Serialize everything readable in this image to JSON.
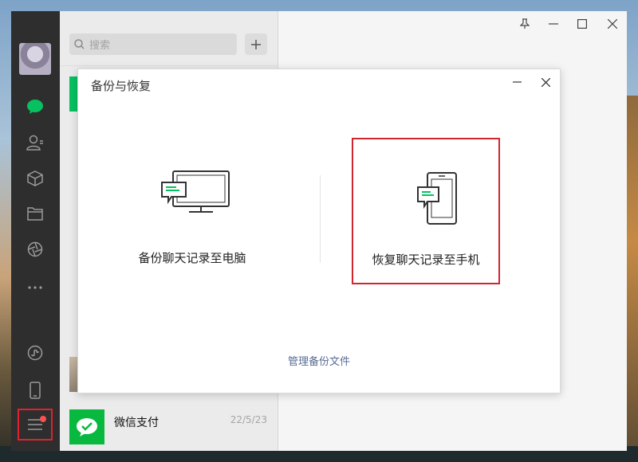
{
  "search": {
    "placeholder": "搜索"
  },
  "chat_list": [
    {
      "name": "微信支付",
      "date": "22/5/23"
    }
  ],
  "dialog": {
    "title": "备份与恢复",
    "options": [
      {
        "label": "备份聊天记录至电脑",
        "icon": "monitor-chat-icon",
        "highlighted": false
      },
      {
        "label": "恢复聊天记录至手机",
        "icon": "phone-chat-icon",
        "highlighted": true
      }
    ],
    "manage_link": "管理备份文件"
  },
  "nav": {
    "items": [
      "chat-icon",
      "contacts-icon",
      "favorites-icon",
      "files-icon",
      "moments-icon",
      "more-icon",
      "miniprogram-icon",
      "phone-icon",
      "menu-icon"
    ],
    "menu_badge": true
  },
  "colors": {
    "accent": "#07c160",
    "highlight_border": "#d0262f",
    "link": "#576b95",
    "sidebar": "#2e2e2e"
  }
}
